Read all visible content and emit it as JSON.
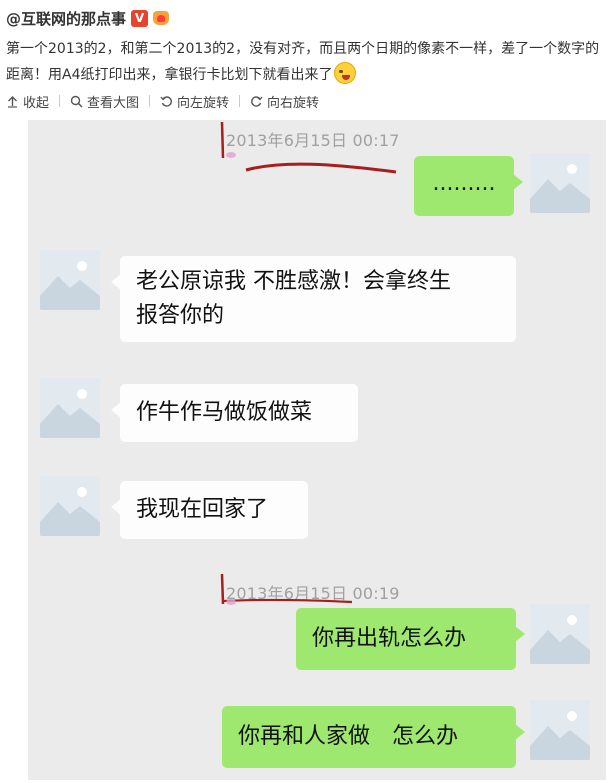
{
  "post": {
    "author": "@互联网的那点事",
    "verified_badge": "V",
    "text_line1": "第一个2013的2，和第二个2013的2，没有对齐，而且两个日期的像素不一样，差了一个数字的",
    "text_line2": "距离！用A4纸打印出来，拿银行卡比划下就看出来了",
    "icons": [
      "verified-v-icon",
      "vip-crown-icon",
      "crying-laughing-emoji"
    ]
  },
  "toolbar": {
    "collapse": "收起",
    "view_large": "查看大图",
    "rotate_left": "向左旋转",
    "rotate_right": "向右旋转"
  },
  "chat": {
    "timestamp1": "2013年6月15日 00:17",
    "timestamp2": "2013年6月15日 00:19",
    "messages": [
      {
        "side": "right",
        "text": "........."
      },
      {
        "side": "left",
        "line1": "老公原谅我 不胜感激！会拿终生",
        "line2": "报答你的"
      },
      {
        "side": "left",
        "text": "作牛作马做饭做菜"
      },
      {
        "side": "left",
        "text": "我现在回家了"
      },
      {
        "side": "right",
        "text": "你再出轨怎么办"
      },
      {
        "side": "right",
        "text": "你再和人家做",
        "text_after": "怎么办"
      }
    ],
    "colors": {
      "background": "#ebebeb",
      "green_bubble": "#9fe870",
      "white_bubble": "#fdfdfd",
      "red_annotation": "#a81e1e"
    }
  }
}
